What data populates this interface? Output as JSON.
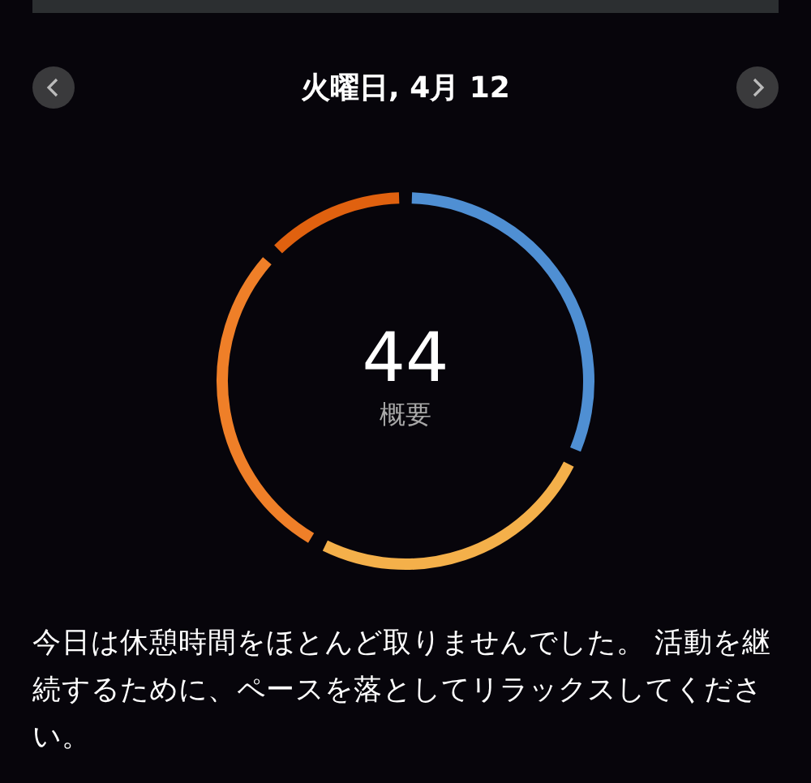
{
  "header": {
    "date": "火曜日, 4月 12"
  },
  "score": {
    "value": "44",
    "label": "概要"
  },
  "message": "今日は休憩時間をほとんど取りませんでした。 活動を継続するために、ペースを落としてリラックスしてください。"
}
